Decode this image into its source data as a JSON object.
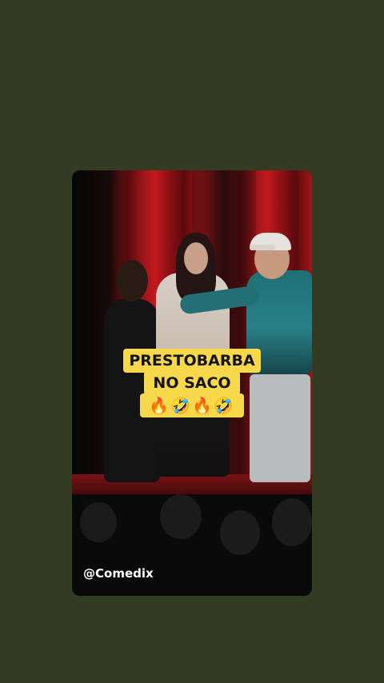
{
  "story": {
    "caption_lines": [
      "PRESTOBARBA",
      "NO SACO",
      "🔥🤣🔥🤣"
    ],
    "watermark": "@Comedix"
  },
  "colors": {
    "background": "#343b23",
    "caption_bg": "#f6d84a",
    "curtain": "#c2191e"
  }
}
